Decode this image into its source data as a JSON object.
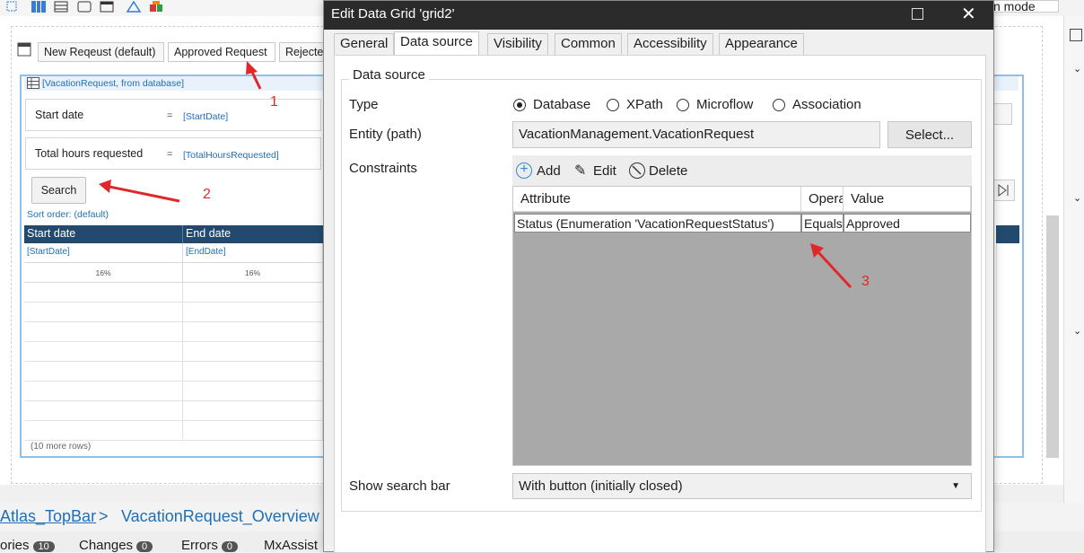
{
  "toolbar": {
    "icons": [
      "select-icon",
      "layout-icon",
      "database-icon",
      "square-icon",
      "window-icon",
      "shape-icon",
      "module-icon"
    ]
  },
  "designer": {
    "tabs": [
      "New Reqeust (default)",
      "Approved Request",
      "Rejecte"
    ],
    "grid_caption": "[VacationRequest, from database]",
    "search_fields": [
      {
        "label": "Start date",
        "eq": "=",
        "value": "[StartDate]"
      },
      {
        "label": "Total hours requested",
        "eq": "=",
        "value": "[TotalHoursRequested]"
      }
    ],
    "search_button": "Search",
    "sort_order": "Sort order: (default)",
    "columns": [
      {
        "header": "Start date",
        "value": "[StartDate]",
        "width": "16%"
      },
      {
        "header": "End date",
        "value": "[EndDate]",
        "width": "16%"
      }
    ],
    "more_rows": "(10 more rows)"
  },
  "right_panel": {
    "partial_text": "n mode"
  },
  "breadcrumb": {
    "first": "Atlas_TopBar",
    "separator": ">",
    "second": "VacationRequest_Overview"
  },
  "status_bar": {
    "items": [
      {
        "label": "ories",
        "count": "10"
      },
      {
        "label": "Changes",
        "count": "0"
      },
      {
        "label": "Errors",
        "count": "0"
      },
      {
        "label": "MxAssist",
        "count": ""
      }
    ]
  },
  "dialog": {
    "title": "Edit Data Grid 'grid2'",
    "tabs": [
      "General",
      "Data source",
      "Visibility",
      "Common",
      "Accessibility",
      "Appearance"
    ],
    "group_title": "Data source",
    "type_label": "Type",
    "type_options": [
      "Database",
      "XPath",
      "Microflow",
      "Association"
    ],
    "type_selected": "Database",
    "entity_label": "Entity (path)",
    "entity_value": "VacationManagement.VacationRequest",
    "select_button": "Select...",
    "constraints_label": "Constraints",
    "constraint_actions": [
      "Add",
      "Edit",
      "Delete"
    ],
    "constraint_columns": [
      "Attribute",
      "Operator",
      "Value"
    ],
    "constraint_rows": [
      {
        "attribute": "Status (Enumeration 'VacationRequestStatus')",
        "operator": "Equals",
        "value": "Approved"
      }
    ],
    "search_bar_label": "Show search bar",
    "search_bar_value": "With button (initially closed)"
  },
  "annotations": {
    "marker1": "1",
    "marker2": "2",
    "marker3": "3",
    "color": "#e0282a"
  }
}
